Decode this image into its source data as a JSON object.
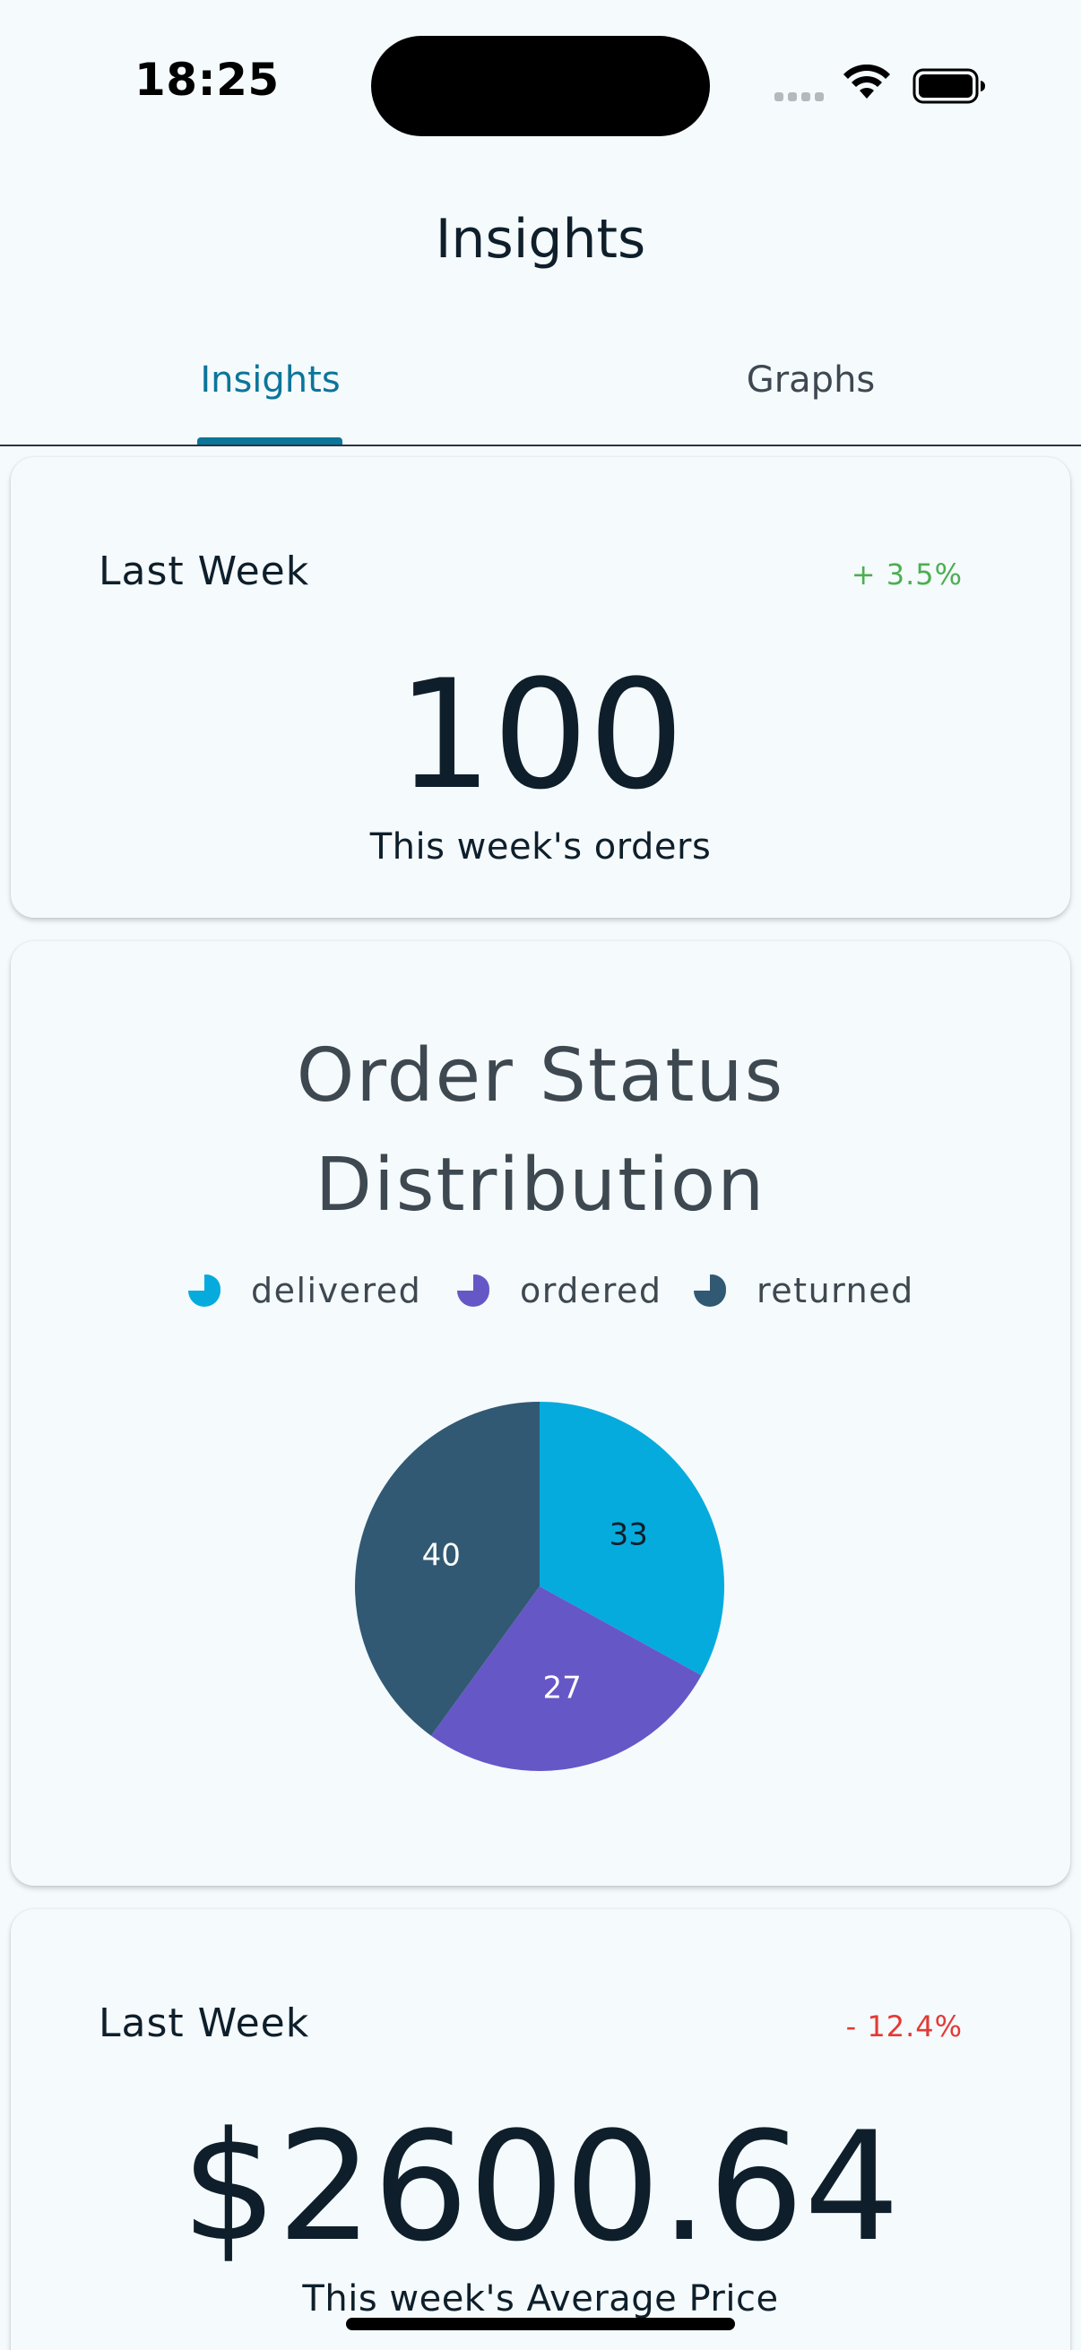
{
  "status_bar": {
    "time": "18:25"
  },
  "header": {
    "title": "Insights"
  },
  "tabs": [
    {
      "label": "Insights",
      "active": true
    },
    {
      "label": "Graphs",
      "active": false
    }
  ],
  "orders_card": {
    "label": "Last Week",
    "change": "+ 3.5%",
    "change_color": "#4caf50",
    "value": "100",
    "caption": "This week's orders"
  },
  "status_card": {
    "title_line1": "Order Status",
    "title_line2": "Distribution",
    "chart_data": {
      "type": "pie",
      "title": "Order Status Distribution",
      "legend_position": "top",
      "categories": [
        "delivered",
        "ordered",
        "returned"
      ],
      "values": [
        33,
        27,
        40
      ],
      "colors": [
        "#06abdd",
        "#6657c6",
        "#315973"
      ],
      "label_colors": [
        "#0e1f2b",
        "#ffffff",
        "#ffffff"
      ]
    }
  },
  "price_card": {
    "label": "Last Week",
    "change": "- 12.4%",
    "change_color": "#e53935",
    "value": "$2600.64",
    "caption": "This week's Average Price"
  }
}
